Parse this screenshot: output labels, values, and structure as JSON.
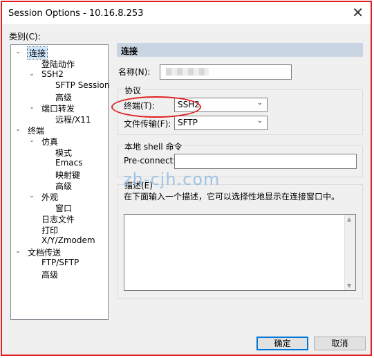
{
  "window": {
    "title": "Session Options - 10.16.8.253",
    "close_glyph": "✕"
  },
  "category_label": "类别(C):",
  "tree": [
    {
      "label": "连接",
      "exp": "⌄",
      "selected": true
    },
    {
      "label": "登陆动作"
    },
    {
      "label": "SSH2",
      "exp": "⌄"
    },
    {
      "label": "SFTP Session"
    },
    {
      "label": "高级"
    },
    {
      "label": "端口转发",
      "exp": "⌄"
    },
    {
      "label": "远程/X11"
    },
    {
      "label": "终端",
      "exp": "⌄"
    },
    {
      "label": "仿真",
      "exp": "⌄"
    },
    {
      "label": "模式"
    },
    {
      "label": "Emacs"
    },
    {
      "label": "映射键"
    },
    {
      "label": "高级"
    },
    {
      "label": "外观",
      "exp": "⌄"
    },
    {
      "label": "窗口"
    },
    {
      "label": "日志文件"
    },
    {
      "label": "打印"
    },
    {
      "label": "X/Y/Zmodem"
    },
    {
      "label": "文档传送",
      "exp": "⌄"
    },
    {
      "label": "FTP/SFTP"
    },
    {
      "label": "高级"
    }
  ],
  "section_title": "连接",
  "name_field": {
    "label": "名称(N):",
    "value": ""
  },
  "protocol_group": {
    "title": "协议",
    "terminal_label": "终端(T):",
    "terminal_value": "SSH2",
    "transfer_label": "文件传输(F):",
    "transfer_value": "SFTP"
  },
  "local_shell_group": {
    "title": "本地 shell 命令",
    "preconnect_label": "Pre-connect:",
    "preconnect_value": ""
  },
  "description_group": {
    "title": "描述(E)",
    "hint": "在下面输入一个描述，它可以选择性地显示在连接窗口中。",
    "value": ""
  },
  "watermark": "zh-cjh.com",
  "buttons": {
    "ok": "确定",
    "cancel": "取消"
  },
  "icons": {
    "dropdown": "chevron-down-icon",
    "close": "close-icon"
  },
  "colors": {
    "highlight": "#e02020",
    "section_header": "#c9d5e3",
    "selection": "#cce8ff"
  }
}
